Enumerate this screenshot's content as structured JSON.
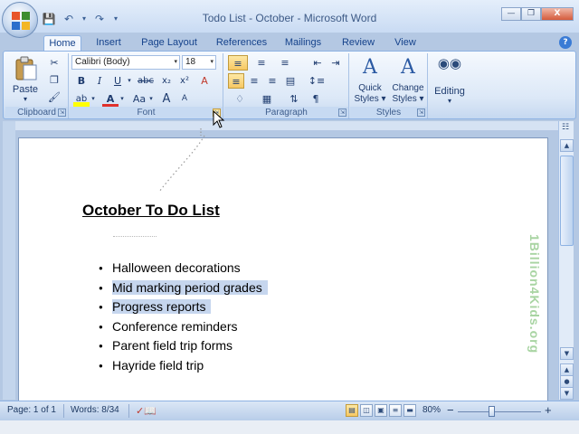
{
  "window": {
    "title": "Todo List - October - Microsoft Word",
    "controls": {
      "minimize": "—",
      "maximize": "❐",
      "close": "X"
    }
  },
  "quick_access": {
    "undo_arrow": "▾",
    "redo_arrow": "▾",
    "customize": "▾"
  },
  "tabs": [
    "Home",
    "Insert",
    "Page Layout",
    "References",
    "Mailings",
    "Review",
    "View"
  ],
  "active_tab": "Home",
  "help": "?",
  "ribbon": {
    "clipboard": {
      "label": "Clipboard",
      "paste_label": "Paste",
      "paste_arrow": "▾",
      "launcher": "⇲"
    },
    "font": {
      "label": "Font",
      "font_name": "Calibri (Body)",
      "font_size": "18",
      "dropdown_arrow": "▾",
      "launcher": "⇲",
      "buttons": {
        "bold": "B",
        "italic": "I",
        "underline": "U",
        "strike": "abc",
        "subscript": "x₂",
        "superscript": "x²",
        "clear": "A",
        "highlight": "ab",
        "font_color": "A",
        "change_case": "Aa",
        "grow": "A",
        "shrink": "A"
      }
    },
    "paragraph": {
      "label": "Paragraph",
      "launcher": "⇲",
      "pilcrow": "¶"
    },
    "styles": {
      "label": "Styles",
      "quick_styles": "Quick Styles ▾",
      "change_styles": "Change Styles ▾",
      "launcher": "⇲"
    },
    "editing": {
      "label": "Editing",
      "arrow": "▾"
    }
  },
  "document": {
    "heading": "October To Do List",
    "items": [
      {
        "text": "Halloween decorations",
        "selected": false
      },
      {
        "text": "Mid marking period grades",
        "selected": true
      },
      {
        "text": "Progress reports",
        "selected": true
      },
      {
        "text": "Conference reminders",
        "selected": false
      },
      {
        "text": "Parent field trip forms",
        "selected": false
      },
      {
        "text": "Hayride field trip",
        "selected": false
      }
    ],
    "watermark": "1Billion4Kids.org"
  },
  "status_bar": {
    "page": "Page: 1 of 1",
    "words": "Words: 8/34",
    "zoom": "80%",
    "zoom_out": "−",
    "zoom_in": "+"
  },
  "colors": {
    "ribbon_blue": "#dce8f7",
    "selection": "#c6d6ee",
    "tab_text": "#15428b",
    "watermark_green": "#9fd099"
  },
  "icons": {
    "office_button": "office-logo-icon",
    "save": "save-icon",
    "undo": "undo-icon",
    "redo": "redo-icon",
    "cut": "scissors-icon",
    "copy": "copy-icon",
    "format_painter": "brush-icon",
    "bullets": "bullet-list-icon",
    "numbering": "numbered-list-icon",
    "multilevel": "multilevel-list-icon",
    "find": "binoculars-icon",
    "proofing": "proofing-book-icon"
  }
}
